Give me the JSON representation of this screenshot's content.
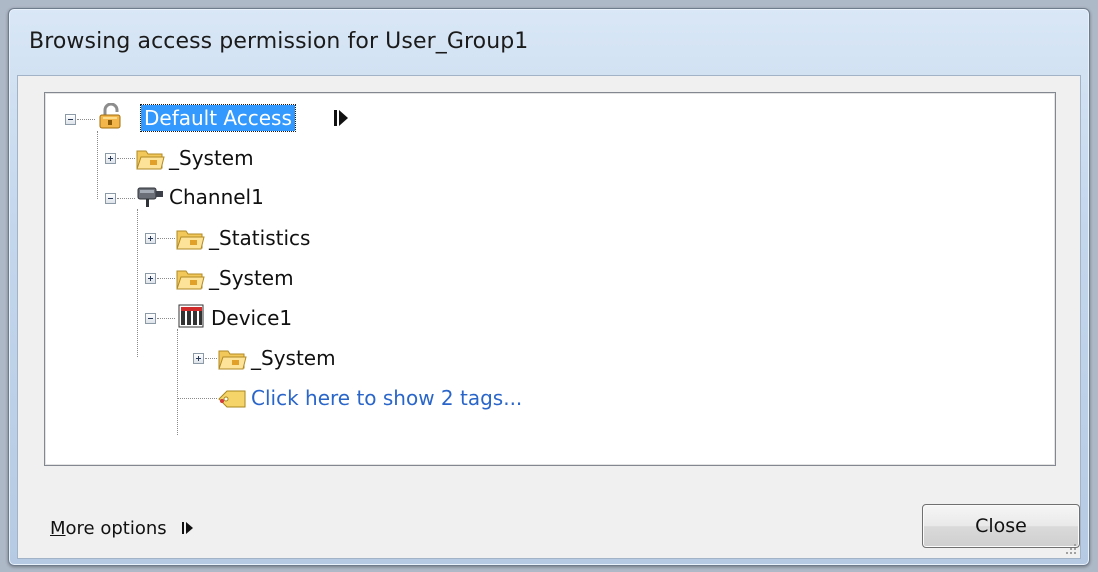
{
  "window": {
    "title": "Browsing access permission for User_Group1"
  },
  "tree": {
    "root": {
      "label": "Default Access",
      "icon": "padlock-open-icon",
      "selected": true
    },
    "nodes": [
      {
        "label": "_System",
        "icon": "folder-icon",
        "expander": "plus"
      },
      {
        "label": "Channel1",
        "icon": "channel-icon",
        "expander": "minus"
      },
      {
        "label": "_Statistics",
        "icon": "folder-icon",
        "expander": "plus"
      },
      {
        "label": "_System",
        "icon": "folder-icon",
        "expander": "plus"
      },
      {
        "label": "Device1",
        "icon": "device-icon",
        "expander": "minus"
      },
      {
        "label": "_System",
        "icon": "folder-icon",
        "expander": "plus"
      },
      {
        "label": "Click here to show 2 tags...",
        "icon": "tag-icon",
        "expander": "none"
      }
    ]
  },
  "footer": {
    "more_options_label": "More options",
    "more_options_underline": "M",
    "more_options_rest": "ore options",
    "close_label": "Close",
    "close_underline": "l"
  },
  "colors": {
    "selection": "#3399ff",
    "link": "#2a66c9",
    "title_gradient_top": "#d9e7f6"
  }
}
